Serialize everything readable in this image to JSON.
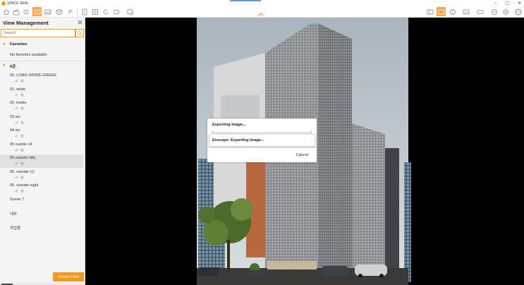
{
  "window": {
    "app_title": "SPACE SEAL",
    "controls": [
      "–",
      "▢",
      "✕"
    ]
  },
  "toolbar": {
    "active_tool": "views",
    "left_icons": [
      "home-icon",
      "clapper-icon",
      "settings-list-icon",
      "views-icon",
      "image-icon",
      "cube-icon",
      "bookmark-icon",
      "doc-icon",
      "grid-doc-icon",
      "rotate-icon",
      "export-icon",
      "export-batch-icon"
    ],
    "right_icons": [
      "panel-left-icon",
      "panel-active-icon",
      "palette-icon",
      "screen-icon",
      "vr-icon",
      "share-icon",
      "gear-icon",
      "help-icon"
    ]
  },
  "panel": {
    "title": "View Management",
    "search_placeholder": "Search",
    "favorites_label": "Favorites",
    "no_favorites": "No favorites available",
    "group_label": "6강_",
    "views": [
      {
        "label": "00. LONG INSIDE GREEN",
        "has_icons": true,
        "selected": false
      },
      {
        "label": "01. white",
        "has_icons": true,
        "selected": false
      },
      {
        "label": "02. inside",
        "has_icons": true,
        "selected": false
      },
      {
        "label": "03.iso",
        "has_icons": true,
        "selected": false
      },
      {
        "label": "04.iso",
        "has_icons": true,
        "selected": false
      },
      {
        "label": "05 ouside 14",
        "has_icons": true,
        "selected": false
      },
      {
        "label": "05 outside hilly",
        "has_icons": true,
        "selected": true
      },
      {
        "label": "05. outside 12",
        "has_icons": true,
        "selected": false
      },
      {
        "label": "05. outside night",
        "has_icons": true,
        "selected": false
      },
      {
        "label": "Scene 7",
        "has_icons": false,
        "selected": false
      },
      {
        "label": "내부",
        "has_icons": false,
        "selected": false
      },
      {
        "label": "작업용",
        "has_icons": false,
        "selected": false
      }
    ],
    "create_button": "Create View"
  },
  "dialog": {
    "title": "Exporting Image...",
    "subtitle": "Enscape: Exporting Image...",
    "cancel_label": "Cancel"
  },
  "colors": {
    "accent": "#f39a1c",
    "panel_bg": "#f4f4f4",
    "viewport_bg": "#000000"
  }
}
